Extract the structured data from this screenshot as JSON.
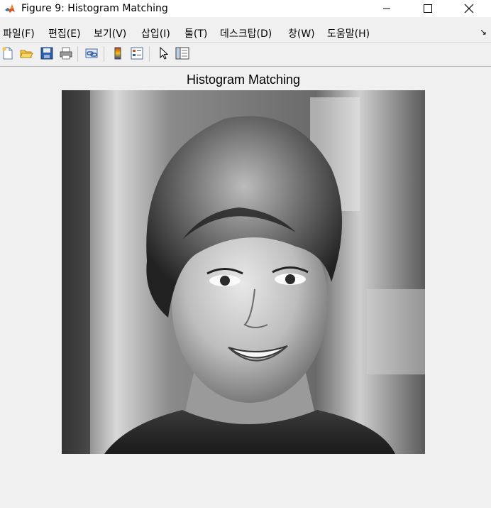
{
  "window": {
    "title": "Figure 9: Histogram Matching",
    "minimize_icon": "minimize-icon",
    "maximize_icon": "maximize-icon",
    "close_icon": "close-icon"
  },
  "menubar": {
    "items": [
      {
        "label": "파일(F)"
      },
      {
        "label": "편집(E)"
      },
      {
        "label": "보기(V)"
      },
      {
        "label": "삽입(I)"
      },
      {
        "label": "툴(T)"
      },
      {
        "label": "데스크탑(D)"
      },
      {
        "label": "창(W)"
      },
      {
        "label": "도움말(H)"
      }
    ],
    "dock_arrow": "↘"
  },
  "toolbar": {
    "buttons": [
      "new-figure-icon",
      "open-file-icon",
      "save-icon",
      "print-icon",
      "link-plot-icon",
      "colorbar-icon",
      "legend-icon",
      "edit-plot-arrow-icon",
      "property-inspector-icon"
    ]
  },
  "axes": {
    "title": "Histogram Matching"
  },
  "image": {
    "description_icon": "grayscale-portrait-image"
  }
}
